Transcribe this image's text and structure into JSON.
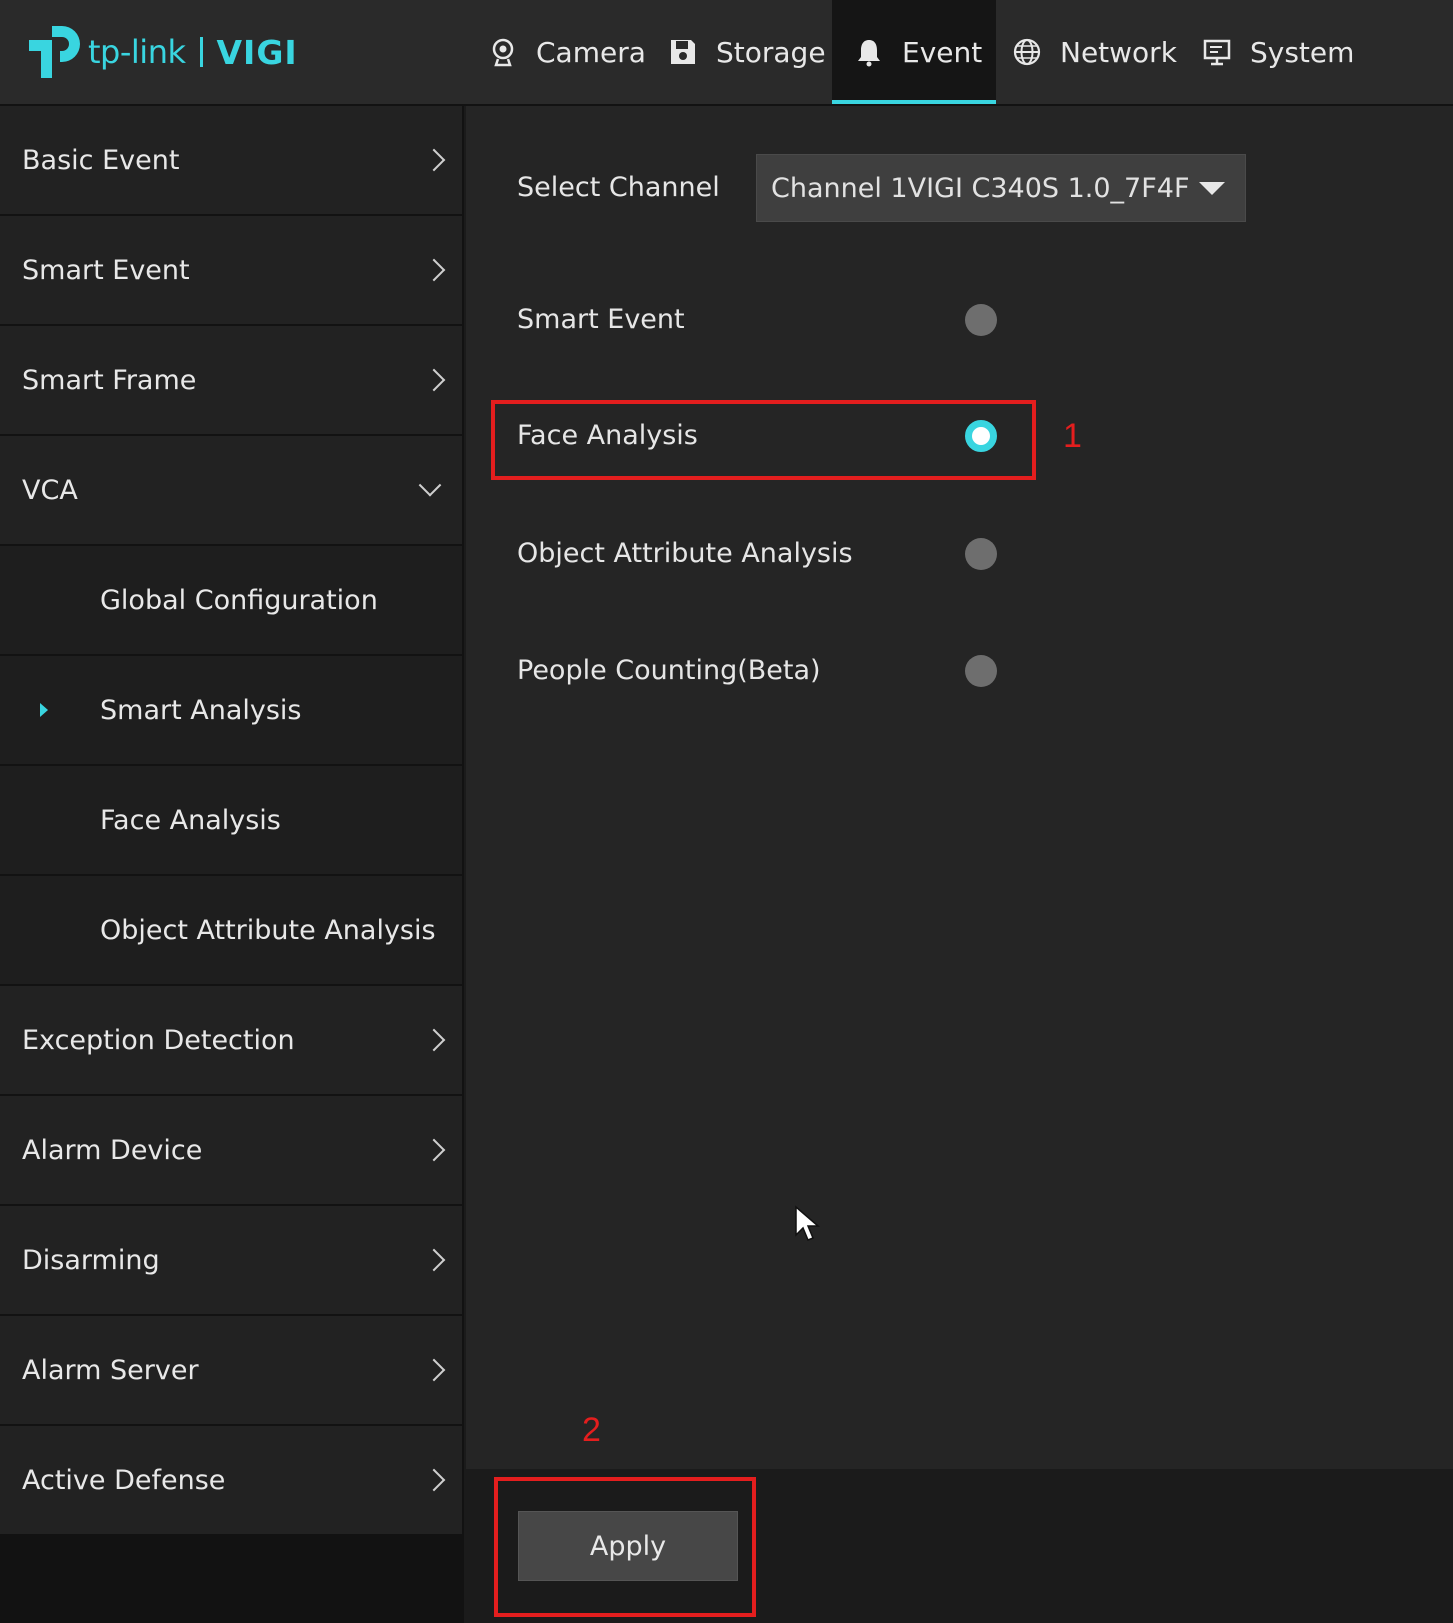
{
  "brand": {
    "logo_text": "tp-link",
    "product": "VIGI",
    "accent": "#39d5e0"
  },
  "nav": {
    "items": [
      {
        "label": "Camera",
        "icon": "camera-icon"
      },
      {
        "label": "Storage",
        "icon": "floppy-disk-icon"
      },
      {
        "label": "Event",
        "icon": "bell-icon",
        "active": true
      },
      {
        "label": "Network",
        "icon": "globe-icon"
      },
      {
        "label": "System",
        "icon": "monitor-icon"
      }
    ]
  },
  "sidebar": {
    "items": [
      {
        "label": "Basic Event",
        "chevron": "right"
      },
      {
        "label": "Smart Event",
        "chevron": "right"
      },
      {
        "label": "Smart Frame",
        "chevron": "right"
      },
      {
        "label": "VCA",
        "chevron": "down",
        "expanded": true
      },
      {
        "label": "Global Configuration",
        "sub": true
      },
      {
        "label": "Smart Analysis",
        "sub": true,
        "selected": true
      },
      {
        "label": "Face Analysis",
        "sub": true
      },
      {
        "label": "Object Attribute Analysis",
        "sub": true
      },
      {
        "label": "Exception Detection",
        "chevron": "right"
      },
      {
        "label": "Alarm Device",
        "chevron": "right"
      },
      {
        "label": "Disarming",
        "chevron": "right"
      },
      {
        "label": "Alarm Server",
        "chevron": "right"
      },
      {
        "label": "Active Defense",
        "chevron": "right"
      }
    ]
  },
  "main": {
    "select_channel_label": "Select Channel",
    "channel_value": "Channel 1VIGI C340S 1.0_7F4F",
    "options": [
      {
        "label": "Smart Event",
        "selected": false
      },
      {
        "label": "Face Analysis",
        "selected": true
      },
      {
        "label": "Object Attribute Analysis",
        "selected": false
      },
      {
        "label": "People Counting(Beta)",
        "selected": false
      }
    ],
    "apply_label": "Apply"
  },
  "annotations": {
    "step1": "1",
    "step2": "2",
    "color": "#e41e1e"
  }
}
